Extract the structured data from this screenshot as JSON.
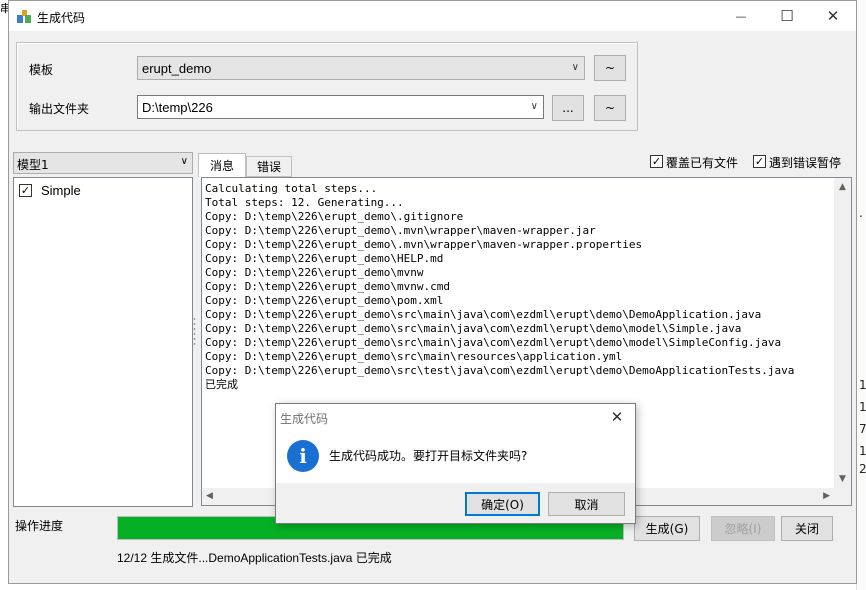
{
  "window": {
    "title": "生成代码",
    "minimize_glyph": "—",
    "maximize_glyph": "☐",
    "close_glyph": "✕",
    "icon": "app-icon"
  },
  "config": {
    "template_label": "模板",
    "template_value": "erupt_demo",
    "template_tilde": "~",
    "output_label": "输出文件夹",
    "output_value": "D:\\temp\\226",
    "browse_label": "...",
    "output_tilde": "~"
  },
  "model": {
    "selected": "模型1",
    "items": [
      {
        "label": "Simple",
        "checked": true
      }
    ]
  },
  "tabs": [
    {
      "label": "消息",
      "active": true
    },
    {
      "label": "错误",
      "active": false
    }
  ],
  "options": {
    "overwrite_label": "覆盖已有文件",
    "overwrite_checked": true,
    "pause_on_error_label": "遇到错误暂停",
    "pause_on_error_checked": true
  },
  "log_lines": [
    "Calculating total steps...",
    "Total steps: 12. Generating...",
    "Copy: D:\\temp\\226\\erupt_demo\\.gitignore",
    "Copy: D:\\temp\\226\\erupt_demo\\.mvn\\wrapper\\maven-wrapper.jar",
    "Copy: D:\\temp\\226\\erupt_demo\\.mvn\\wrapper\\maven-wrapper.properties",
    "Copy: D:\\temp\\226\\erupt_demo\\HELP.md",
    "Copy: D:\\temp\\226\\erupt_demo\\mvnw",
    "Copy: D:\\temp\\226\\erupt_demo\\mvnw.cmd",
    "Copy: D:\\temp\\226\\erupt_demo\\pom.xml",
    "Copy: D:\\temp\\226\\erupt_demo\\src\\main\\java\\com\\ezdml\\erupt\\demo\\DemoApplication.java",
    "Copy: D:\\temp\\226\\erupt_demo\\src\\main\\java\\com\\ezdml\\erupt\\demo\\model\\Simple.java",
    "Copy: D:\\temp\\226\\erupt_demo\\src\\main\\java\\com\\ezdml\\erupt\\demo\\model\\SimpleConfig.java",
    "Copy: D:\\temp\\226\\erupt_demo\\src\\main\\resources\\application.yml",
    "Copy: D:\\temp\\226\\erupt_demo\\src\\test\\java\\com\\ezdml\\erupt\\demo\\DemoApplicationTests.java",
    "已完成"
  ],
  "progress": {
    "label": "操作进度",
    "fraction": 1.0,
    "status": "12/12 生成文件...DemoApplicationTests.java 已完成",
    "color": "#06b025"
  },
  "actions": {
    "generate": "生成(G)",
    "ignore": "忽略(I)",
    "close": "关闭"
  },
  "dialog": {
    "title": "生成代码",
    "close_glyph": "✕",
    "icon_glyph": "i",
    "message": "生成代码成功。要打开目标文件夹吗?",
    "ok": "确定(O)",
    "cancel": "取消"
  },
  "background_chars": [
    "串",
    ".",
    "1",
    "1",
    "7",
    "1",
    "2"
  ],
  "colors": {
    "accent": "#0078d7",
    "info_icon": "#1a6fd2"
  }
}
